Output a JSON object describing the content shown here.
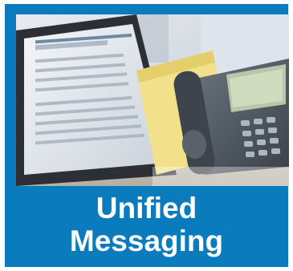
{
  "tile": {
    "caption_line1": "Unified",
    "caption_line2": "Messaging",
    "background_color": "#0a7bbc",
    "text_color": "#ffffff"
  },
  "photo": {
    "subject_icons": [
      "laptop-icon",
      "ip-phone-icon",
      "paper-notepad-icon"
    ]
  }
}
